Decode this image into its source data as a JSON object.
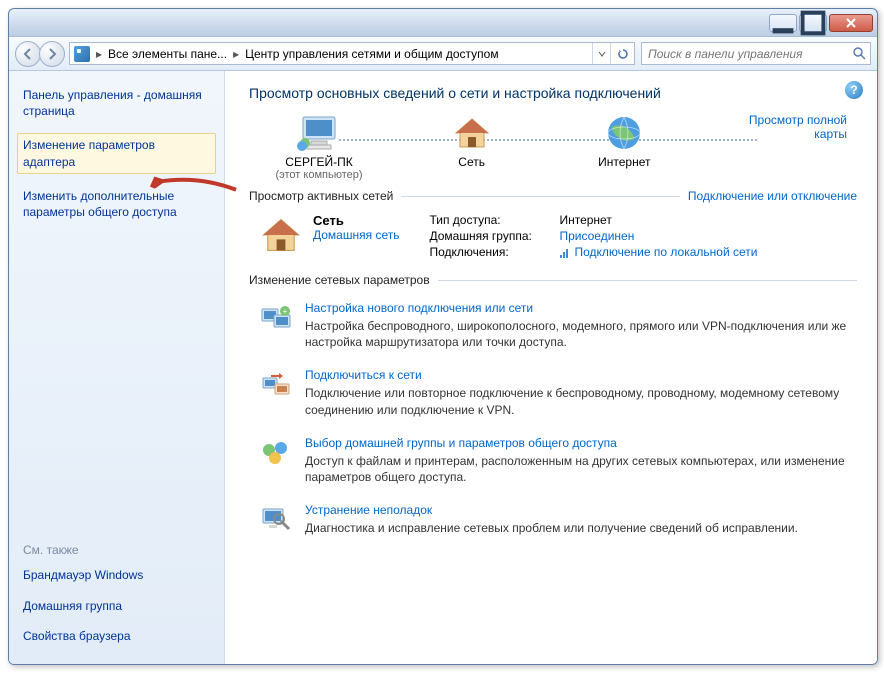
{
  "breadcrumb": {
    "part1": "Все элементы пане...",
    "part2": "Центр управления сетями и общим доступом"
  },
  "search": {
    "placeholder": "Поиск в панели управления"
  },
  "sidebar": {
    "home": "Панель управления - домашняя страница",
    "links": [
      "Изменение параметров адаптера",
      "Изменить дополнительные параметры общего доступа"
    ],
    "see_also_label": "См. также",
    "see_also": [
      "Брандмауэр Windows",
      "Домашняя группа",
      "Свойства браузера"
    ]
  },
  "page_title": "Просмотр основных сведений о сети и настройка подключений",
  "map": {
    "node1": "СЕРГЕЙ-ПК",
    "node1_sub": "(этот компьютер)",
    "node2": "Сеть",
    "node3": "Интернет",
    "full_map": "Просмотр полной карты"
  },
  "active": {
    "header": "Просмотр активных сетей",
    "connect_toggle": "Подключение или отключение",
    "net_name": "Сеть",
    "net_type": "Домашняя сеть",
    "details": {
      "access_k": "Тип доступа:",
      "access_v": "Интернет",
      "homegroup_k": "Домашняя группа:",
      "homegroup_v": "Присоединен",
      "conn_k": "Подключения:",
      "conn_v": "Подключение по локальной сети"
    }
  },
  "change": {
    "header": "Изменение сетевых параметров",
    "tasks": [
      {
        "title": "Настройка нового подключения или сети",
        "desc": "Настройка беспроводного, широкополосного, модемного, прямого или VPN-подключения или же настройка маршрутизатора или точки доступа."
      },
      {
        "title": "Подключиться к сети",
        "desc": "Подключение или повторное подключение к беспроводному, проводному, модемному сетевому соединению или подключение к VPN."
      },
      {
        "title": "Выбор домашней группы и параметров общего доступа",
        "desc": "Доступ к файлам и принтерам, расположенным на других сетевых компьютерах, или изменение параметров общего доступа."
      },
      {
        "title": "Устранение неполадок",
        "desc": "Диагностика и исправление сетевых проблем или получение сведений об исправлении."
      }
    ]
  }
}
